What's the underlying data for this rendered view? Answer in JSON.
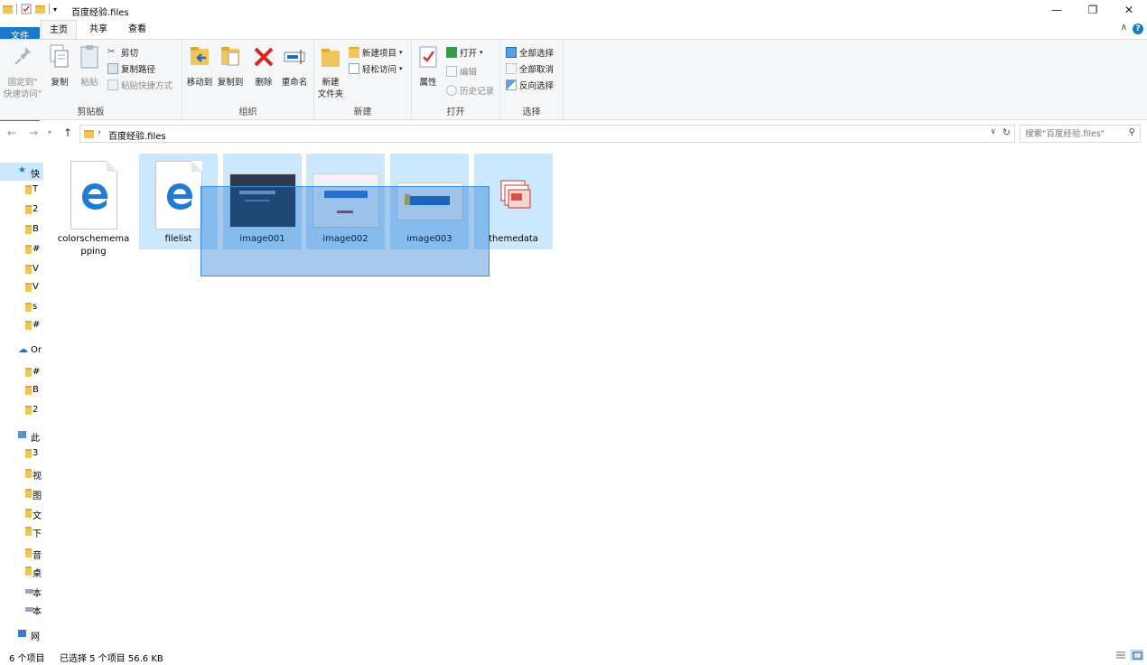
{
  "window": {
    "title": "百度经验.files",
    "minimize": "—",
    "maximize": "❐",
    "close": "✕"
  },
  "tabs": {
    "file": "文件",
    "home": "主页",
    "share": "共享",
    "view": "查看"
  },
  "ribbon": {
    "clipboard": {
      "label": "剪贴板",
      "pin": "固定到\"\n快速访问\"",
      "copy": "复制",
      "paste": "粘贴",
      "cut": "剪切",
      "copy_path": "复制路径",
      "paste_shortcut": "粘贴快捷方式"
    },
    "organize": {
      "label": "组织",
      "move_to": "移动到",
      "copy_to": "复制到",
      "delete": "删除",
      "rename": "重命名"
    },
    "new": {
      "label": "新建",
      "new_folder": "新建\n文件夹",
      "new_item": "新建项目",
      "easy_access": "轻松访问"
    },
    "open": {
      "label": "打开",
      "properties": "属性",
      "open": "打开",
      "edit": "编辑",
      "history": "历史记录"
    },
    "select": {
      "label": "选择",
      "select_all": "全部选择",
      "select_none": "全部取消",
      "invert": "反向选择"
    }
  },
  "address": {
    "path": "百度经验.files",
    "search_placeholder": "搜索\"百度经验.files\""
  },
  "nav": {
    "items": [
      {
        "label": "快",
        "icon": "star-icon"
      },
      {
        "label": "T",
        "icon": "folder-icon"
      },
      {
        "label": "2",
        "icon": "folder-icon"
      },
      {
        "label": "B",
        "icon": "folder-icon"
      },
      {
        "label": "#",
        "icon": "folder-icon"
      },
      {
        "label": "V",
        "icon": "folder-icon"
      },
      {
        "label": "V",
        "icon": "folder-icon"
      },
      {
        "label": "s",
        "icon": "folder-icon"
      },
      {
        "label": "#",
        "icon": "folder-icon"
      },
      {
        "label": "Or",
        "icon": "cloud-icon"
      },
      {
        "label": "#",
        "icon": "folder-icon"
      },
      {
        "label": "B",
        "icon": "folder-icon"
      },
      {
        "label": "2",
        "icon": "folder-icon"
      },
      {
        "label": "此",
        "icon": "computer-icon"
      },
      {
        "label": "3",
        "icon": "folder-icon"
      },
      {
        "label": "视",
        "icon": "folder-icon"
      },
      {
        "label": "图",
        "icon": "folder-icon"
      },
      {
        "label": "文",
        "icon": "folder-icon"
      },
      {
        "label": "下",
        "icon": "folder-icon"
      },
      {
        "label": "音",
        "icon": "folder-icon"
      },
      {
        "label": "桌",
        "icon": "folder-icon"
      },
      {
        "label": "本",
        "icon": "drive-icon"
      },
      {
        "label": "本",
        "icon": "drive-icon"
      },
      {
        "label": "网",
        "icon": "network-icon"
      }
    ]
  },
  "files": [
    {
      "name": "colorschememapping",
      "type": "edge",
      "selected": false
    },
    {
      "name": "filelist",
      "type": "edge",
      "selected": true
    },
    {
      "name": "image001",
      "type": "image-dark",
      "selected": true
    },
    {
      "name": "image002",
      "type": "image-light",
      "selected": true
    },
    {
      "name": "image003",
      "type": "image-logo",
      "selected": true
    },
    {
      "name": "themedata",
      "type": "ppt",
      "selected": true
    }
  ],
  "status": {
    "count": "6 个项目",
    "selected": "已选择 5 个项目  56.6 KB"
  },
  "colors": {
    "accent": "#1979ca",
    "selection": "#cce8ff",
    "folder": "#f2c55c"
  }
}
